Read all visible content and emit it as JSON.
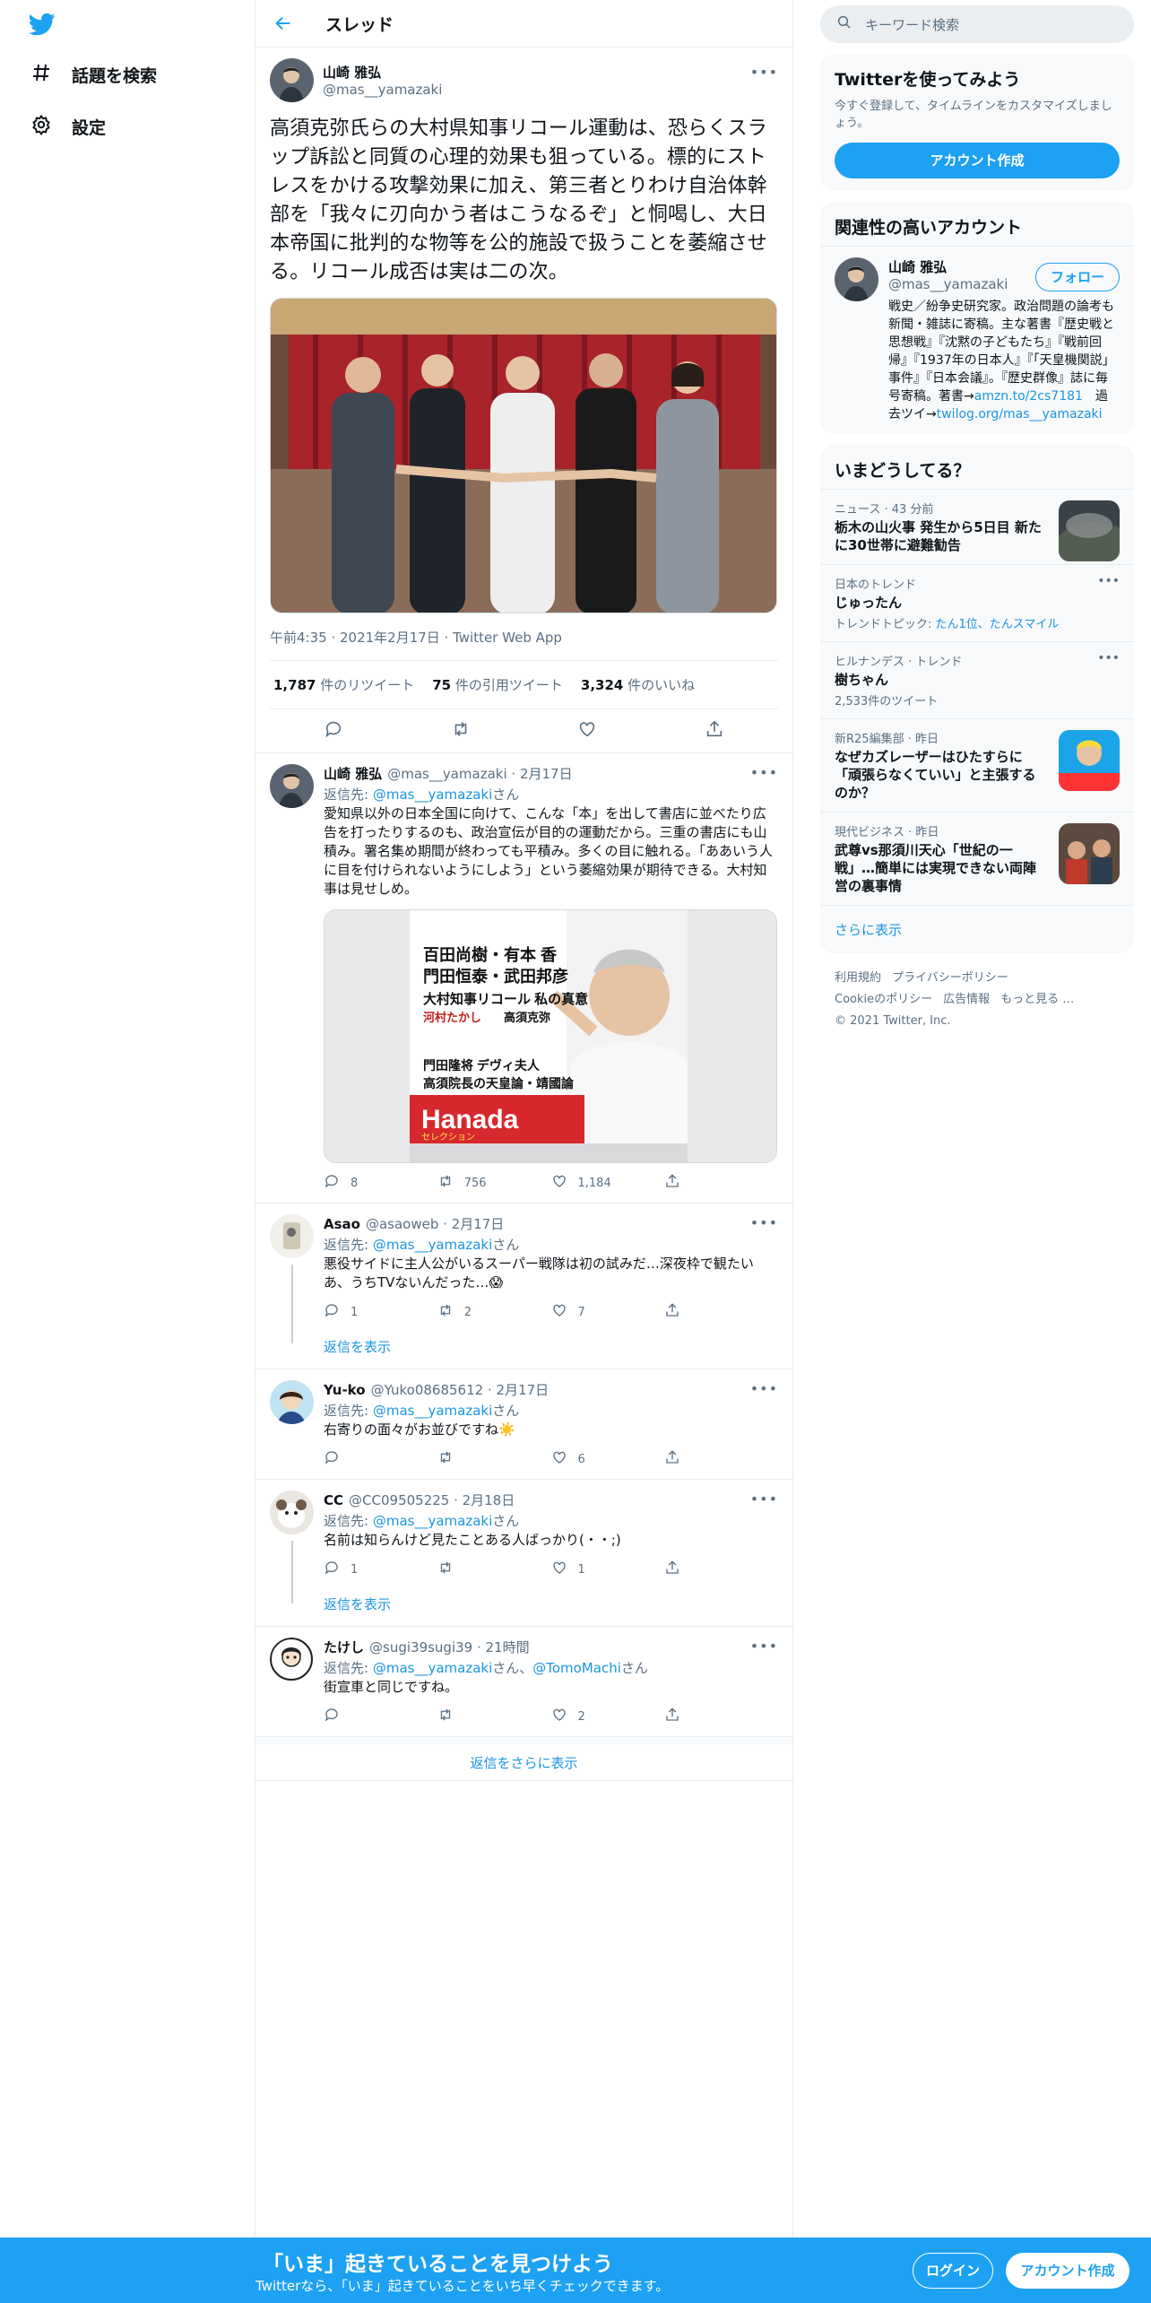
{
  "nav": {
    "explore_label": "話題を検索",
    "settings_label": "設定"
  },
  "header": {
    "title": "スレッド"
  },
  "focus_tweet": {
    "name": "山崎 雅弘",
    "handle": "@mas__yamazaki",
    "text": "高須克弥氏らの大村県知事リコール運動は、恐らくスラップ訴訟と同質の心理的効果も狙っている。標的にストレスをかける攻撃効果に加え、第三者とりわけ自治体幹部を「我々に刃向かう者はこうなるぞ」と恫喝し、大日本帝国に批判的な物等を公的施設で扱うことを萎縮させる。リコール成否は実は二の次。",
    "meta": "午前4:35 · 2021年2月17日 · Twitter Web App",
    "retweets": "1,787",
    "retweets_label": "件のリツイート",
    "quotes": "75",
    "quotes_label": "件の引用ツイート",
    "likes": "3,324",
    "likes_label": "件のいいね"
  },
  "replies": [
    {
      "name": "山崎 雅弘",
      "handle_time": "@mas__yamazaki · 2月17日",
      "reply_to_prefix": "返信先: ",
      "reply_to": "@mas__yamazaki",
      "reply_to_suffix": "さん",
      "text": "愛知県以外の日本全国に向けて、こんな「本」を出して書店に並べたり広告を打ったりするのも、政治宣伝が目的の運動だから。三重の書店にも山積み。署名集め期間が終わっても平積み。多くの目に触れる。「ああいう人に目を付けられないようにしよう」という萎縮効果が期待できる。大村知事は見せしめ。",
      "replies_count": "8",
      "retweets_count": "756",
      "likes_count": "1,184",
      "magazine": {
        "title": "Hanada",
        "sub": "セレクション",
        "line1": "百田尚樹・有本 香",
        "line2": "門田隆将 デヴィ夫人",
        "line3": "高須院長の天皇論・靖國論",
        "line4": "門田恒泰・武田邦彦",
        "line5": "大村知事リコール 私の真意",
        "line6": "河村たかし",
        "line7": "高須克弥"
      }
    },
    {
      "name": "Asao",
      "handle_time": "@asaoweb · 2月17日",
      "reply_to_prefix": "返信先: ",
      "reply_to": "@mas__yamazaki",
      "reply_to_suffix": "さん",
      "text": "悪役サイドに主人公がいるスーパー戦隊は初の試みだ…深夜枠で観たいあ、うちTVないんだった…😱",
      "replies_count": "1",
      "retweets_count": "2",
      "likes_count": "7",
      "show_replies": "返信を表示"
    },
    {
      "name": "Yu-ko",
      "handle_time": "@Yuko08685612 · 2月17日",
      "reply_to_prefix": "返信先: ",
      "reply_to": "@mas__yamazaki",
      "reply_to_suffix": "さん",
      "text": "右寄りの面々がお並びですね☀️",
      "replies_count": "",
      "retweets_count": "",
      "likes_count": "6"
    },
    {
      "name": "CC",
      "handle_time": "@CC09505225 · 2月18日",
      "reply_to_prefix": "返信先: ",
      "reply_to": "@mas__yamazaki",
      "reply_to_suffix": "さん",
      "text": "名前は知らんけど見たことある人ばっかり(・・;)",
      "replies_count": "1",
      "retweets_count": "",
      "likes_count": "1",
      "show_replies": "返信を表示"
    },
    {
      "name": "たけし",
      "handle_time": "@sugi39sugi39 · 21時間",
      "reply_to_prefix": "返信先: ",
      "reply_to": "@mas__yamazaki",
      "reply_to_suffix": "さん、",
      "reply_to2": "@TomoMachi",
      "reply_to2_suffix": "さん",
      "text": "街宣車と同じですね。",
      "replies_count": "",
      "retweets_count": "",
      "likes_count": "2"
    }
  ],
  "more_replies": "返信をさらに表示",
  "search": {
    "placeholder": "キーワード検索"
  },
  "signup_card": {
    "title": "Twitterを使ってみよう",
    "desc": "今すぐ登録して、タイムラインをカスタマイズしましょう。",
    "button": "アカウント作成"
  },
  "related": {
    "title": "関連性の高いアカウント",
    "name": "山崎 雅弘",
    "handle": "@mas__yamazaki",
    "follow": "フォロー",
    "bio": "戦史／紛争史研究家。政治問題の論考も新聞・雑誌に寄稿。主な著書『歴史戦と思想戦』『沈黙の子どもたち』『戦前回帰』『1937年の日本人』『「天皇機関説」事件』『日本会議』。『歴史群像』誌に毎号寄稿。著書→",
    "bio_link1": "amzn.to/2cs7181",
    "bio_mid": "　過去ツイ→",
    "bio_link2": "twilog.org/mas__yamazaki"
  },
  "trends": {
    "title": "いまどうしてる？",
    "items": [
      {
        "context": "ニュース · 43 分前",
        "title": "栃木の山火事 発生から5日目 新たに30世帯に避難勧告",
        "sub": ""
      },
      {
        "context": "日本のトレンド",
        "title": "じゅったん",
        "sub_prefix": "トレンドトピック: ",
        "sub": "たん1位、たんスマイル"
      },
      {
        "context": "ヒルナンデス · トレンド",
        "title": "樹ちゃん",
        "sub": "2,533件のツイート"
      },
      {
        "context": "新R25編集部 · 昨日",
        "title": "なぜカズレーザーはひたすらに「頑張らなくていい」と主張するのか？",
        "sub": ""
      },
      {
        "context": "現代ビジネス · 昨日",
        "title": "武尊vs那須川天心「世紀の一戦」…簡単には実現できない両陣営の裏事情",
        "sub": ""
      }
    ],
    "show_more": "さらに表示"
  },
  "footer": {
    "terms": "利用規約",
    "privacy": "プライバシーポリシー",
    "cookie": "Cookieのポリシー",
    "ads": "広告情報",
    "more": "もっと見る …",
    "copyright": "© 2021 Twitter, Inc."
  },
  "bottom_bar": {
    "title": "「いま」起きていることを見つけよう",
    "sub": "Twitterなら、「いま」起きていることをいち早くチェックできます。",
    "login": "ログイン",
    "signup": "アカウント作成"
  },
  "colors": {
    "accent": "#1da1f2",
    "link": "#1b95e0",
    "muted": "#5b7083"
  }
}
